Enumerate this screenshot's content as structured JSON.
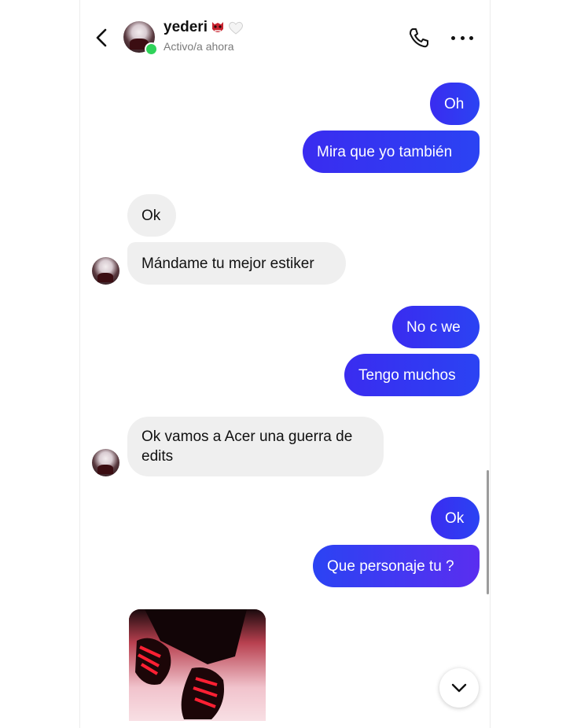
{
  "header": {
    "contact_name": "yederi",
    "status": "Activo/a ahora",
    "icons": [
      "back-chevron-icon",
      "phone-icon",
      "more-dots-icon",
      "ogre-mask-emoji",
      "white-heart-emoji"
    ]
  },
  "messages": [
    {
      "side": "out",
      "text": "Oh"
    },
    {
      "side": "out",
      "text": "Mira que yo también"
    },
    {
      "side": "in",
      "text": "Ok"
    },
    {
      "side": "in",
      "text": "Mándame tu mejor estiker"
    },
    {
      "side": "out",
      "text": "No c we"
    },
    {
      "side": "out",
      "text": "Tengo muchos"
    },
    {
      "side": "in",
      "text": "Ok vamos a Acer una guerra de edits",
      "lines": [
        "Ok vamos a Acer una guerra de",
        "edits"
      ]
    },
    {
      "side": "out",
      "text": "Ok"
    },
    {
      "side": "out",
      "text": "Que personaje tu ?"
    }
  ],
  "colors": {
    "outgoing_bubble": "#2b43f3",
    "incoming_bubble": "#efefef",
    "online_dot": "#2fd35a"
  }
}
